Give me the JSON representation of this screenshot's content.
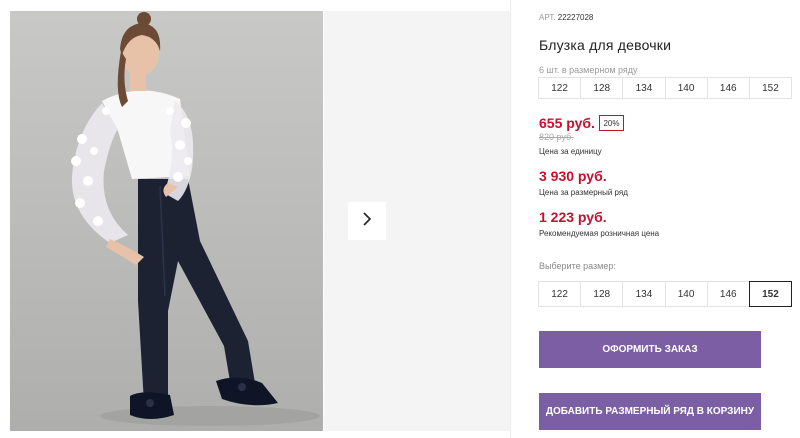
{
  "product": {
    "art_label": "АРТ.",
    "art_number": "22227028",
    "title": "Блузка для девочки",
    "row_label": "6 шт. в размерном ряду",
    "row_sizes": [
      "122",
      "128",
      "134",
      "140",
      "146",
      "152"
    ],
    "price": "655 руб.",
    "discount": "20%",
    "old_price": "820 руб.",
    "price_note": "Цена за единицу",
    "row_price": "3 930 руб.",
    "row_price_note": "Цена за размерный ряд",
    "retail_price": "1 223 руб.",
    "retail_note": "Рекомендуемая розничная цена",
    "choose_label": "Выберите размер:",
    "pick_sizes": [
      "122",
      "128",
      "134",
      "140",
      "146",
      "152"
    ],
    "selected_size": "152"
  },
  "actions": {
    "order": "ОФОРМИТЬ ЗАКАЗ",
    "add_row": "ДОБАВИТЬ РАЗМЕРНЫЙ РЯД В КОРЗИНУ"
  },
  "colors": {
    "accent": "#7b5ea3",
    "price": "#c8102e"
  },
  "icons": {
    "next": "chevron-right-icon"
  }
}
